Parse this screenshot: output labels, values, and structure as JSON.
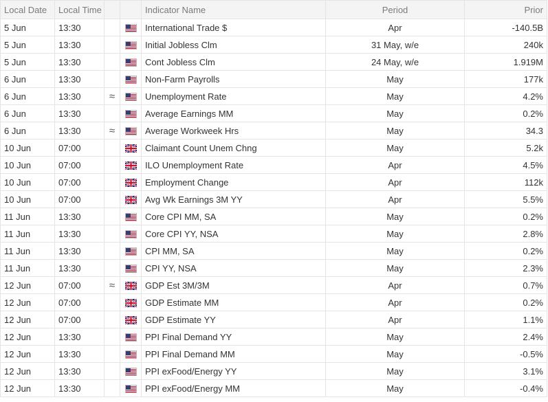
{
  "headers": {
    "local_date": "Local Date",
    "local_time": "Local Time",
    "indicator_name": "Indicator Name",
    "period": "Period",
    "prior": "Prior"
  },
  "colors": {
    "header_bg": "#f4f4f4",
    "border": "#e4e4e4",
    "us_red": "#c8102e",
    "us_blue": "#3c3b6e",
    "uk_blue": "#012169",
    "uk_red": "#c8102e"
  },
  "rows": [
    {
      "date": "5 Jun",
      "time": "13:30",
      "approx": "",
      "flag": "us-flag-icon",
      "indicator": "International Trade $",
      "period": "Apr",
      "prior": "-140.5B"
    },
    {
      "date": "5 Jun",
      "time": "13:30",
      "approx": "",
      "flag": "us-flag-icon",
      "indicator": "Initial Jobless Clm",
      "period": "31 May, w/e",
      "prior": "240k"
    },
    {
      "date": "5 Jun",
      "time": "13:30",
      "approx": "",
      "flag": "us-flag-icon",
      "indicator": "Cont Jobless Clm",
      "period": "24 May, w/e",
      "prior": "1.919M"
    },
    {
      "date": "6 Jun",
      "time": "13:30",
      "approx": "",
      "flag": "us-flag-icon",
      "indicator": "Non-Farm Payrolls",
      "period": "May",
      "prior": "177k"
    },
    {
      "date": "6 Jun",
      "time": "13:30",
      "approx": "≈",
      "flag": "us-flag-icon",
      "indicator": "Unemployment Rate",
      "period": "May",
      "prior": "4.2%"
    },
    {
      "date": "6 Jun",
      "time": "13:30",
      "approx": "",
      "flag": "us-flag-icon",
      "indicator": "Average Earnings MM",
      "period": "May",
      "prior": "0.2%"
    },
    {
      "date": "6 Jun",
      "time": "13:30",
      "approx": "≈",
      "flag": "us-flag-icon",
      "indicator": "Average Workweek Hrs",
      "period": "May",
      "prior": "34.3"
    },
    {
      "date": "10 Jun",
      "time": "07:00",
      "approx": "",
      "flag": "uk-flag-icon",
      "indicator": "Claimant Count Unem Chng",
      "period": "May",
      "prior": "5.2k"
    },
    {
      "date": "10 Jun",
      "time": "07:00",
      "approx": "",
      "flag": "uk-flag-icon",
      "indicator": "ILO Unemployment Rate",
      "period": "Apr",
      "prior": "4.5%"
    },
    {
      "date": "10 Jun",
      "time": "07:00",
      "approx": "",
      "flag": "uk-flag-icon",
      "indicator": "Employment Change",
      "period": "Apr",
      "prior": "112k"
    },
    {
      "date": "10 Jun",
      "time": "07:00",
      "approx": "",
      "flag": "uk-flag-icon",
      "indicator": "Avg Wk Earnings 3M YY",
      "period": "Apr",
      "prior": "5.5%"
    },
    {
      "date": "11 Jun",
      "time": "13:30",
      "approx": "",
      "flag": "us-flag-icon",
      "indicator": "Core CPI MM, SA",
      "period": "May",
      "prior": "0.2%"
    },
    {
      "date": "11 Jun",
      "time": "13:30",
      "approx": "",
      "flag": "us-flag-icon",
      "indicator": "Core CPI YY, NSA",
      "period": "May",
      "prior": "2.8%"
    },
    {
      "date": "11 Jun",
      "time": "13:30",
      "approx": "",
      "flag": "us-flag-icon",
      "indicator": "CPI MM, SA",
      "period": "May",
      "prior": "0.2%"
    },
    {
      "date": "11 Jun",
      "time": "13:30",
      "approx": "",
      "flag": "us-flag-icon",
      "indicator": "CPI YY, NSA",
      "period": "May",
      "prior": "2.3%"
    },
    {
      "date": "12 Jun",
      "time": "07:00",
      "approx": "≈",
      "flag": "uk-flag-icon",
      "indicator": "GDP Est 3M/3M",
      "period": "Apr",
      "prior": "0.7%"
    },
    {
      "date": "12 Jun",
      "time": "07:00",
      "approx": "",
      "flag": "uk-flag-icon",
      "indicator": "GDP Estimate MM",
      "period": "Apr",
      "prior": "0.2%"
    },
    {
      "date": "12 Jun",
      "time": "07:00",
      "approx": "",
      "flag": "uk-flag-icon",
      "indicator": "GDP Estimate YY",
      "period": "Apr",
      "prior": "1.1%"
    },
    {
      "date": "12 Jun",
      "time": "13:30",
      "approx": "",
      "flag": "us-flag-icon",
      "indicator": "PPI Final Demand YY",
      "period": "May",
      "prior": "2.4%"
    },
    {
      "date": "12 Jun",
      "time": "13:30",
      "approx": "",
      "flag": "us-flag-icon",
      "indicator": "PPI Final Demand MM",
      "period": "May",
      "prior": "-0.5%"
    },
    {
      "date": "12 Jun",
      "time": "13:30",
      "approx": "",
      "flag": "us-flag-icon",
      "indicator": "PPI exFood/Energy YY",
      "period": "May",
      "prior": "3.1%"
    },
    {
      "date": "12 Jun",
      "time": "13:30",
      "approx": "",
      "flag": "us-flag-icon",
      "indicator": "PPI exFood/Energy MM",
      "period": "May",
      "prior": "-0.4%"
    }
  ]
}
